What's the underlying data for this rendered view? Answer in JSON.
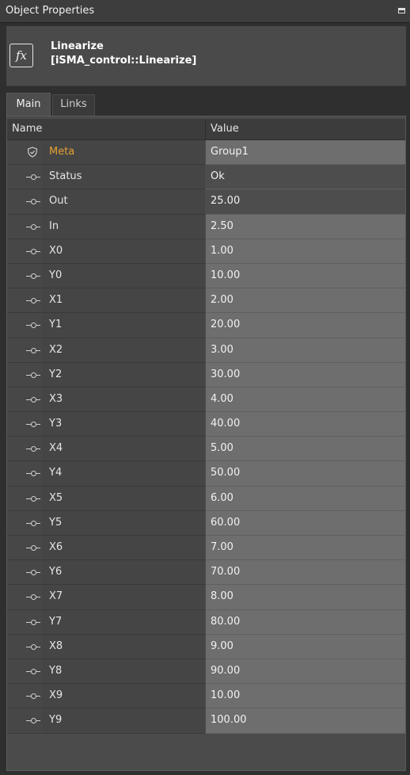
{
  "panel": {
    "title": "Object Properties"
  },
  "object": {
    "name": "Linearize",
    "type": "[iSMA_control::Linearize]",
    "icon": "fx-icon"
  },
  "tabs": [
    {
      "label": "Main",
      "active": true
    },
    {
      "label": "Links",
      "active": false
    }
  ],
  "grid": {
    "columns": {
      "name": "Name",
      "value": "Value"
    },
    "rows": [
      {
        "label": "Meta",
        "value": "Group1",
        "icon": "shield-icon",
        "kind": "meta"
      },
      {
        "label": "Status",
        "value": "Ok",
        "icon": "slot-pin-icon",
        "kind": "ro"
      },
      {
        "label": "Out",
        "value": "25.00",
        "icon": "slot-pin-icon",
        "kind": "ro"
      },
      {
        "label": "In",
        "value": "2.50",
        "icon": "slot-pin-icon",
        "kind": "edit"
      },
      {
        "label": "X0",
        "value": "1.00",
        "icon": "slot-pin-icon",
        "kind": "edit"
      },
      {
        "label": "Y0",
        "value": "10.00",
        "icon": "slot-pin-icon",
        "kind": "edit"
      },
      {
        "label": "X1",
        "value": "2.00",
        "icon": "slot-pin-icon",
        "kind": "edit"
      },
      {
        "label": "Y1",
        "value": "20.00",
        "icon": "slot-pin-icon",
        "kind": "edit"
      },
      {
        "label": "X2",
        "value": "3.00",
        "icon": "slot-pin-icon",
        "kind": "edit"
      },
      {
        "label": "Y2",
        "value": "30.00",
        "icon": "slot-pin-icon",
        "kind": "edit"
      },
      {
        "label": "X3",
        "value": "4.00",
        "icon": "slot-pin-icon",
        "kind": "edit"
      },
      {
        "label": "Y3",
        "value": "40.00",
        "icon": "slot-pin-icon",
        "kind": "edit"
      },
      {
        "label": "X4",
        "value": "5.00",
        "icon": "slot-pin-icon",
        "kind": "edit"
      },
      {
        "label": "Y4",
        "value": "50.00",
        "icon": "slot-pin-icon",
        "kind": "edit"
      },
      {
        "label": "X5",
        "value": "6.00",
        "icon": "slot-pin-icon",
        "kind": "edit"
      },
      {
        "label": "Y5",
        "value": "60.00",
        "icon": "slot-pin-icon",
        "kind": "edit"
      },
      {
        "label": "X6",
        "value": "7.00",
        "icon": "slot-pin-icon",
        "kind": "edit"
      },
      {
        "label": "Y6",
        "value": "70.00",
        "icon": "slot-pin-icon",
        "kind": "edit"
      },
      {
        "label": "X7",
        "value": "8.00",
        "icon": "slot-pin-icon",
        "kind": "edit"
      },
      {
        "label": "Y7",
        "value": "80.00",
        "icon": "slot-pin-icon",
        "kind": "edit"
      },
      {
        "label": "X8",
        "value": "9.00",
        "icon": "slot-pin-icon",
        "kind": "edit"
      },
      {
        "label": "Y8",
        "value": "90.00",
        "icon": "slot-pin-icon",
        "kind": "edit"
      },
      {
        "label": "X9",
        "value": "10.00",
        "icon": "slot-pin-icon",
        "kind": "edit"
      },
      {
        "label": "Y9",
        "value": "100.00",
        "icon": "slot-pin-icon",
        "kind": "edit"
      }
    ]
  },
  "colors": {
    "meta_label": "#e5a033",
    "editable_value_bg": "#6e6e6e",
    "readonly_value_bg": "#4d4d4d"
  }
}
